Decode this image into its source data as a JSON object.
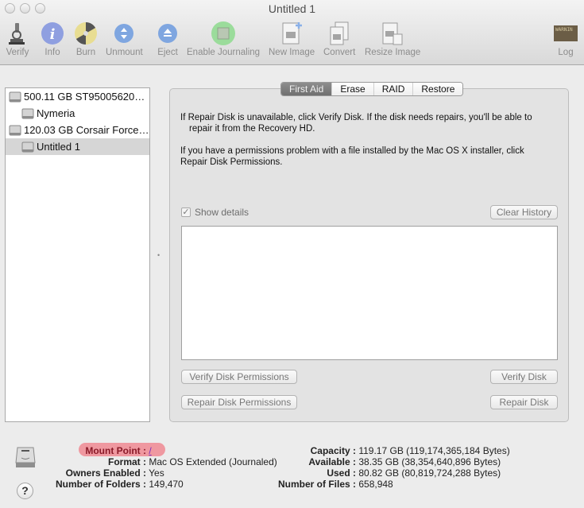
{
  "window": {
    "title": "Untitled 1"
  },
  "toolbar": {
    "items": [
      {
        "label": "Verify",
        "icon": "microscope-icon"
      },
      {
        "label": "Info",
        "icon": "info-icon"
      },
      {
        "label": "Burn",
        "icon": "burn-icon"
      },
      {
        "label": "Unmount",
        "icon": "unmount-icon"
      },
      {
        "label": "Eject",
        "icon": "eject-icon"
      },
      {
        "label": "Enable Journaling",
        "icon": "journaling-icon"
      },
      {
        "label": "New Image",
        "icon": "new-image-icon"
      },
      {
        "label": "Convert",
        "icon": "convert-icon"
      },
      {
        "label": "Resize Image",
        "icon": "resize-image-icon"
      },
      {
        "label": "Log",
        "icon": "log-icon"
      }
    ],
    "log_icon_text": "WARNIN"
  },
  "sidebar": {
    "disks": [
      {
        "label": "500.11 GB ST95005620…",
        "level": 0,
        "selected": false
      },
      {
        "label": "Nymeria",
        "level": 1,
        "selected": false
      },
      {
        "label": "120.03 GB Corsair Force…",
        "level": 0,
        "selected": false
      },
      {
        "label": "Untitled 1",
        "level": 1,
        "selected": true
      }
    ]
  },
  "tabs": [
    {
      "label": "First Aid",
      "active": true
    },
    {
      "label": "Erase",
      "active": false
    },
    {
      "label": "RAID",
      "active": false
    },
    {
      "label": "Restore",
      "active": false
    }
  ],
  "first_aid": {
    "info_1_line1": "If Repair Disk is unavailable, click Verify Disk. If the disk needs repairs, you'll be able to",
    "info_1_line2": "repair it from the Recovery HD.",
    "info_2_line1": "If you have a permissions problem with a file installed by the Mac OS X installer, click",
    "info_2_line2": "Repair Disk Permissions.",
    "show_details_label": "Show details",
    "show_details_checked": true,
    "clear_history_label": "Clear History",
    "verify_permissions_label": "Verify Disk Permissions",
    "repair_permissions_label": "Repair Disk Permissions",
    "verify_disk_label": "Verify Disk",
    "repair_disk_label": "Repair Disk"
  },
  "disk_info": {
    "left": [
      {
        "key": "Mount Point :",
        "value": "/"
      },
      {
        "key": "Format :",
        "value": "Mac OS Extended (Journaled)"
      },
      {
        "key": "Owners Enabled :",
        "value": "Yes"
      },
      {
        "key": "Number of Folders :",
        "value": "149,470"
      }
    ],
    "right": [
      {
        "key": "Capacity :",
        "value": "119.17 GB (119,174,365,184 Bytes)"
      },
      {
        "key": "Available :",
        "value": "38.35 GB (38,354,640,896 Bytes)"
      },
      {
        "key": "Used :",
        "value": "80.82 GB (80,819,724,288 Bytes)"
      },
      {
        "key": "Number of Files :",
        "value": "658,948"
      }
    ],
    "help_label": "?"
  }
}
